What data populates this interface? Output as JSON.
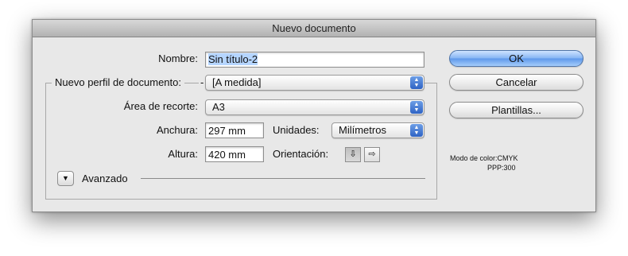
{
  "window": {
    "title": "Nuevo documento"
  },
  "form": {
    "name_label": "Nombre:",
    "name_value": "Sin título-2",
    "profile_label": "Nuevo perfil de documento:",
    "profile_value": "[A medida]",
    "artboard_label": "Área de recorte:",
    "artboard_value": "A3",
    "width_label": "Anchura:",
    "width_value": "297 mm",
    "units_label": "Unidades:",
    "units_value": "Milímetros",
    "height_label": "Altura:",
    "height_value": "420 mm",
    "orientation_label": "Orientación:",
    "advanced_label": "Avanzado"
  },
  "buttons": {
    "ok": "OK",
    "cancel": "Cancelar",
    "templates": "Plantillas..."
  },
  "info": {
    "color_mode": "Modo de color:CMYK",
    "ppi": "PPP:300"
  },
  "icons": {
    "popup_arrows": "updown-arrows-icon",
    "portrait": "portrait-orientation-icon",
    "landscape": "landscape-orientation-icon",
    "disclosure": "disclosure-triangle-icon"
  },
  "colors": {
    "selection": "#b5d5ff",
    "default_button": "#6fa3ec"
  }
}
